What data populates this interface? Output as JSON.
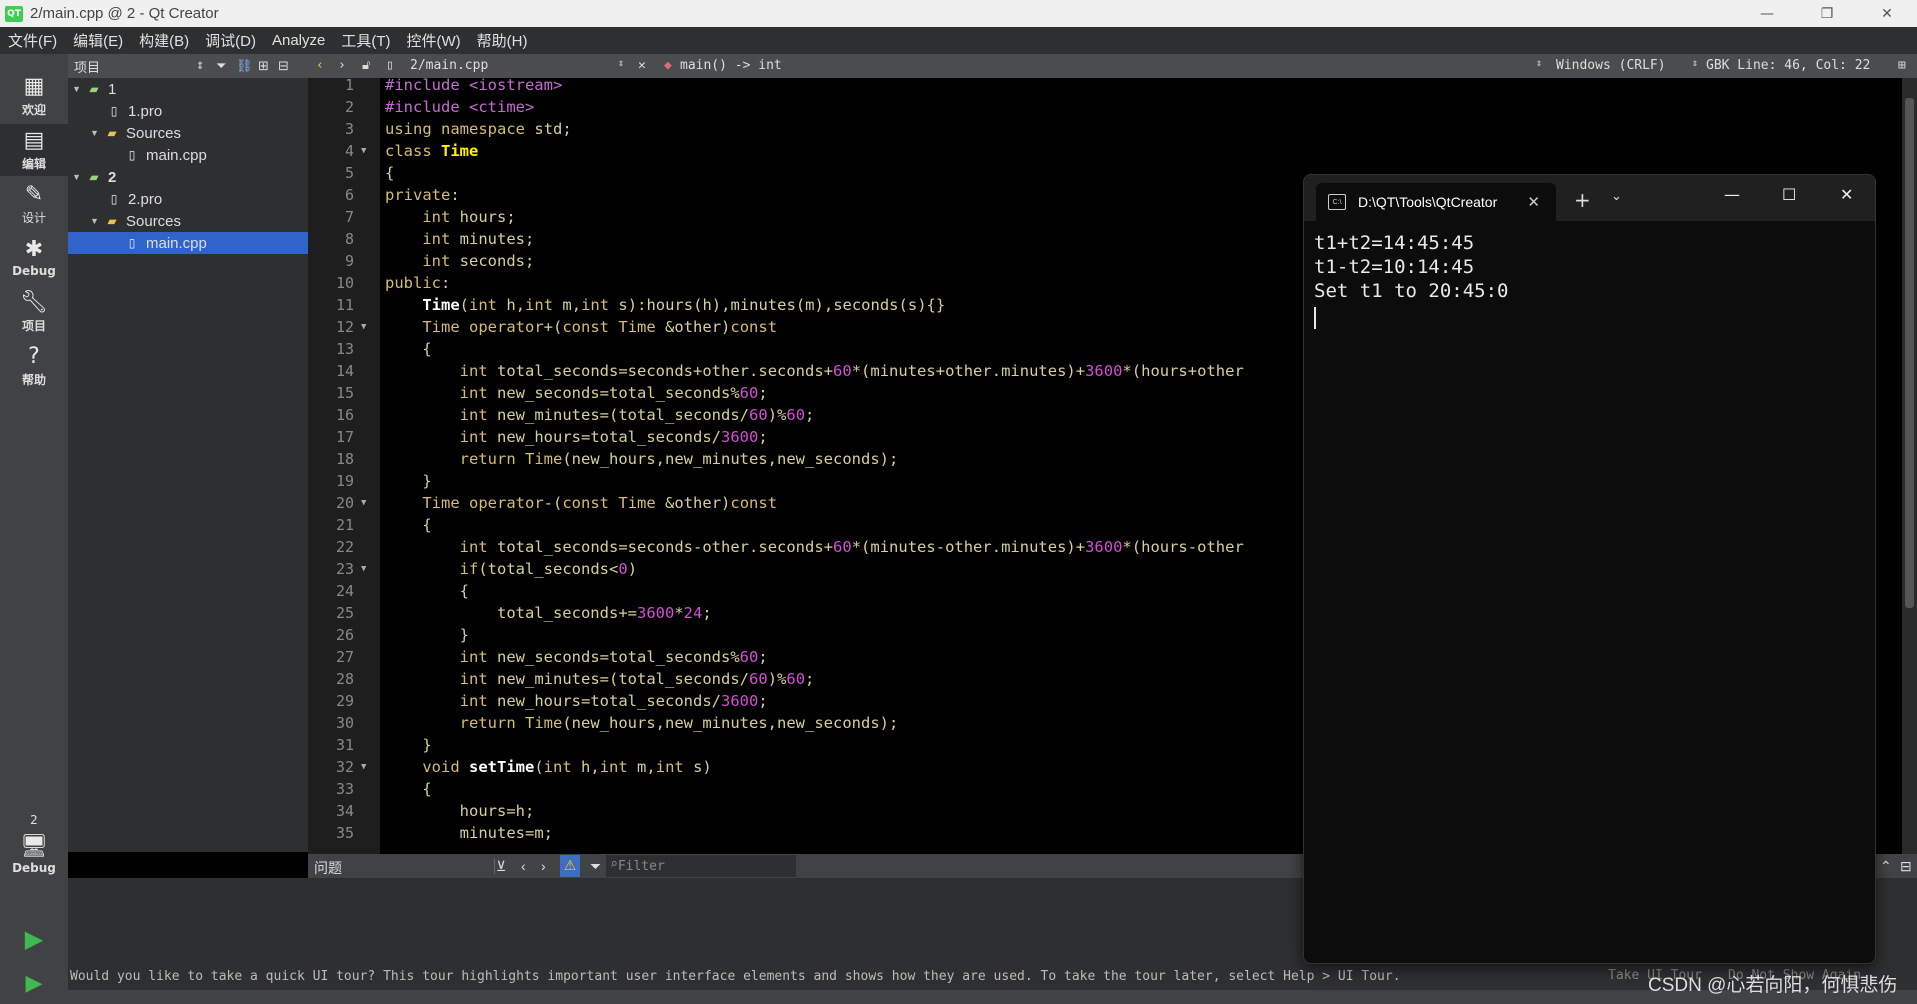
{
  "window": {
    "title": "2/main.cpp @ 2 - Qt Creator",
    "app_icon": "QT",
    "controls": [
      "—",
      "❐",
      "✕"
    ]
  },
  "menu": [
    "文件(F)",
    "编辑(E)",
    "构建(B)",
    "调试(D)",
    "Analyze",
    "工具(T)",
    "控件(W)",
    "帮助(H)"
  ],
  "modes": [
    {
      "label": "欢迎",
      "icon": "grid-icon"
    },
    {
      "label": "编辑",
      "icon": "edit-icon"
    },
    {
      "label": "设计",
      "icon": "pencil-icon"
    },
    {
      "label": "Debug",
      "icon": "bug-icon"
    },
    {
      "label": "项目",
      "icon": "wrench-icon"
    },
    {
      "label": "帮助",
      "icon": "help-icon"
    }
  ],
  "kit": {
    "number": "2",
    "label": "Debug"
  },
  "project_panel": {
    "title": "项目",
    "tree": [
      {
        "label": "1",
        "level": 0,
        "kind": "project"
      },
      {
        "label": "1.pro",
        "level": 1,
        "kind": "file"
      },
      {
        "label": "Sources",
        "level": 1,
        "kind": "folder"
      },
      {
        "label": "main.cpp",
        "level": 2,
        "kind": "file"
      },
      {
        "label": "2",
        "level": 0,
        "kind": "project"
      },
      {
        "label": "2.pro",
        "level": 1,
        "kind": "file"
      },
      {
        "label": "Sources",
        "level": 1,
        "kind": "folder"
      },
      {
        "label": "main.cpp",
        "level": 2,
        "kind": "file",
        "selected": true
      }
    ]
  },
  "editor": {
    "file": "2/main.cpp",
    "symbol": "main() -> int",
    "encoding": "Windows (CRLF)",
    "position": "GBK Line: 46, Col: 22"
  },
  "code_lines": [
    "#include <iostream>",
    "#include <ctime>",
    "using namespace std;",
    "class Time",
    "{",
    "private:",
    "    int hours;",
    "    int minutes;",
    "    int seconds;",
    "public:",
    "    Time(int h,int m,int s):hours(h),minutes(m),seconds(s){}",
    "    Time operator+(const Time &other)const",
    "    {",
    "        int total_seconds=seconds+other.seconds+60*(minutes+other.minutes)+3600*(hours+other",
    "        int new_seconds=total_seconds%60;",
    "        int new_minutes=(total_seconds/60)%60;",
    "        int new_hours=total_seconds/3600;",
    "        return Time(new_hours,new_minutes,new_seconds);",
    "    }",
    "    Time operator-(const Time &other)const",
    "    {",
    "        int total_seconds=seconds-other.seconds+60*(minutes-other.minutes)+3600*(hours-other",
    "        if(total_seconds<0)",
    "        {",
    "            total_seconds+=3600*24;",
    "        }",
    "        int new_seconds=total_seconds%60;",
    "        int new_minutes=(total_seconds/60)%60;",
    "        int new_hours=total_seconds/3600;",
    "        return Time(new_hours,new_minutes,new_seconds);",
    "    }",
    "    void setTime(int h,int m,int s)",
    "    {",
    "        hours=h;",
    "        minutes=m;"
  ],
  "fold_lines": [
    4,
    12,
    20,
    23,
    32
  ],
  "issues": {
    "title": "问题",
    "filter_placeholder": "Filter"
  },
  "tour": {
    "message": "Would you like to take a quick UI tour? This tour highlights important user interface elements and shows how they are used. To take the tour later, select Help > UI Tour.",
    "take_label": "Take UI Tour",
    "dismiss_label": "Do Not Show Again"
  },
  "terminal": {
    "tab_title": "D:\\QT\\Tools\\QtCreator",
    "output": [
      "t1+t2=14:45:45",
      "t1-t2=10:14:45",
      "Set t1 to 20:45:0"
    ]
  },
  "watermark": "CSDN @心若向阳，何惧悲伤"
}
